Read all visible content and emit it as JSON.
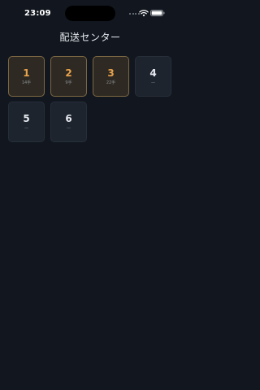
{
  "status_bar": {
    "time": "23:09",
    "icons": [
      "signal-dots-icon",
      "wifi-icon",
      "battery-icon"
    ]
  },
  "header": {
    "title": "配送センター"
  },
  "colors": {
    "background": "#12171f",
    "tile_active_bg": "#2e2a23",
    "tile_active_border": "#7d6743",
    "tile_active_number": "#e8a24c",
    "tile_empty_bg": "#1d242e"
  },
  "tiles": [
    {
      "number": "1",
      "sub": "14手",
      "state": "active"
    },
    {
      "number": "2",
      "sub": "9手",
      "state": "active"
    },
    {
      "number": "3",
      "sub": "22手",
      "state": "active"
    },
    {
      "number": "4",
      "sub": "—",
      "state": "empty"
    },
    {
      "number": "5",
      "sub": "—",
      "state": "empty"
    },
    {
      "number": "6",
      "sub": "—",
      "state": "empty"
    }
  ]
}
